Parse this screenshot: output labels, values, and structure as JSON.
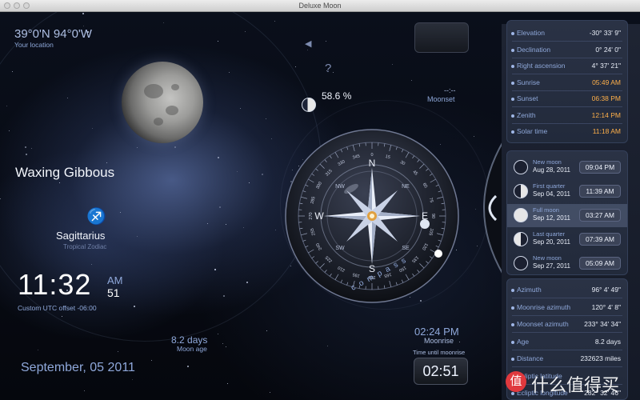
{
  "window": {
    "title": "Deluxe Moon"
  },
  "location": {
    "coords": "39°0'N 94°0'W",
    "label": "Your location"
  },
  "phase": {
    "name": "Waxing Gibbous",
    "illumination": "58.6 %"
  },
  "zodiac": {
    "sign": "Sagittarius",
    "type": "Tropical Zodiac",
    "glyph": "♐"
  },
  "clock": {
    "time": "11:32",
    "ampm": "AM",
    "seconds": "51",
    "offset": "Custom UTC offset -06:00"
  },
  "moon_age": {
    "value": "8.2 days",
    "label": "Moon age"
  },
  "date": "September, 05 2011",
  "moonset": {
    "value": "--:--",
    "label": "Moonset"
  },
  "moonrise": {
    "time": "02:24 PM",
    "label": "Moonrise",
    "until_label": "Time until moonrise",
    "countdown": "02:51"
  },
  "top_icons": {
    "speaker": "◀",
    "help": "?"
  },
  "compass": {
    "label": "compass",
    "cardinals": {
      "n": "N",
      "s": "S",
      "e": "E",
      "w": "W"
    },
    "intercardinals": {
      "ne": "NE",
      "nw": "NW",
      "se": "SE",
      "sw": "SW"
    },
    "degrees": [
      "0",
      "15",
      "30",
      "45",
      "60",
      "75",
      "90",
      "105",
      "120",
      "135",
      "150",
      "165",
      "180",
      "195",
      "210",
      "225",
      "240",
      "255",
      "270",
      "285",
      "300",
      "315",
      "330",
      "345"
    ]
  },
  "info_top": [
    {
      "label": "Elevation",
      "value": "-30° 33' 9\"",
      "orange": false
    },
    {
      "label": "Declination",
      "value": "0° 24' 0\"",
      "orange": false
    },
    {
      "label": "Right ascension",
      "value": "4° 37' 21\"",
      "orange": false
    },
    {
      "label": "Sunrise",
      "value": "05:49 AM",
      "orange": true
    },
    {
      "label": "Sunset",
      "value": "06:38 PM",
      "orange": true
    },
    {
      "label": "Zenith",
      "value": "12:14 PM",
      "orange": true
    },
    {
      "label": "Solar time",
      "value": "11:18 AM",
      "orange": true
    }
  ],
  "phases": [
    {
      "name": "New moon",
      "date": "Aug 28, 2011",
      "time": "09:04 PM"
    },
    {
      "name": "First quarter",
      "date": "Sep 04, 2011",
      "time": "11:39 AM"
    },
    {
      "name": "Full moon",
      "date": "Sep 12, 2011",
      "time": "03:27 AM"
    },
    {
      "name": "Last quarter",
      "date": "Sep 20, 2011",
      "time": "07:39 AM"
    },
    {
      "name": "New moon",
      "date": "Sep 27, 2011",
      "time": "05:09 AM"
    }
  ],
  "info_bottom": [
    {
      "label": "Azimuth",
      "value": "96° 4' 49\""
    },
    {
      "label": "Moonrise azimuth",
      "value": "120° 4' 8\""
    },
    {
      "label": "Moonset azimuth",
      "value": "233° 34' 34\""
    },
    {
      "label": "Age",
      "value": "8.2 days"
    },
    {
      "label": "Distance",
      "value": "232623 miles"
    },
    {
      "label": "Ecliptic latitude",
      "value": ""
    },
    {
      "label": "Ecliptic longitude",
      "value": "282° 32' 46\""
    }
  ],
  "watermark": {
    "glyph": "值",
    "text": "什么值得买"
  }
}
